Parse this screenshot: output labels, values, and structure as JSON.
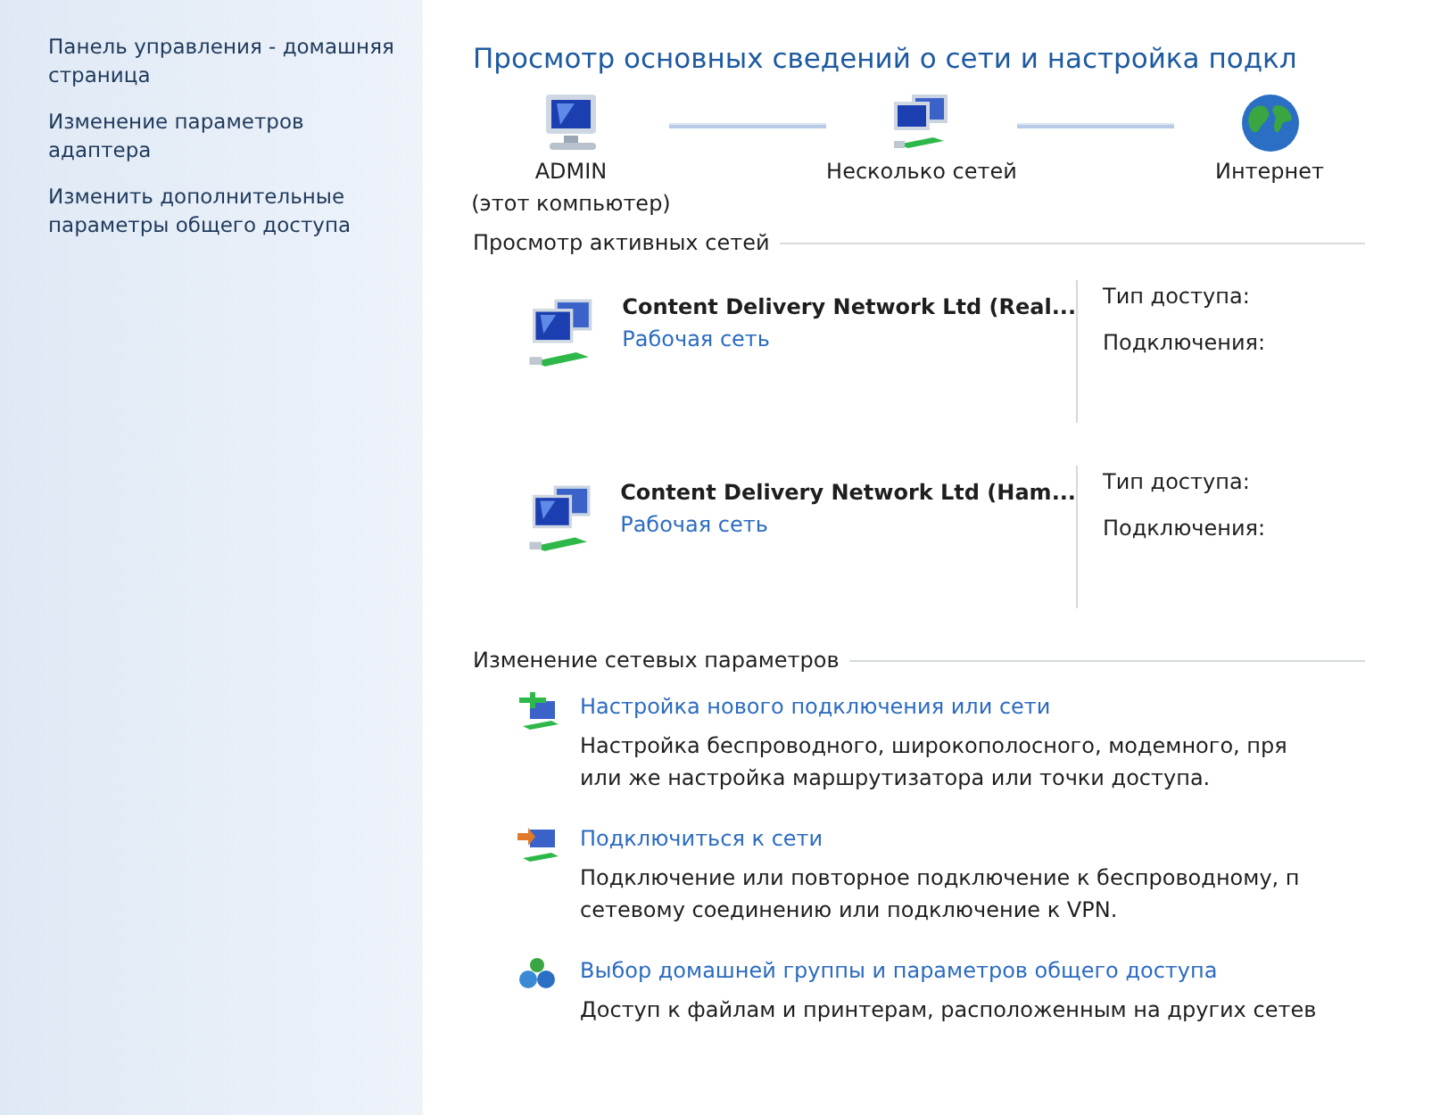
{
  "sidebar": {
    "links": [
      {
        "text": "Панель управления - домашняя страница"
      },
      {
        "text": "Изменение параметров адаптера"
      },
      {
        "text": "Изменить дополнительные параметры общего доступа"
      }
    ]
  },
  "title": "Просмотр основных сведений о сети и настройка подкл",
  "network_map": {
    "nodes": [
      {
        "kind": "computer",
        "label": "ADMIN",
        "sublabel": "(этот компьютер)"
      },
      {
        "kind": "networks",
        "label": "Несколько сетей"
      },
      {
        "kind": "internet",
        "label": "Интернет"
      }
    ]
  },
  "active_networks": {
    "heading": "Просмотр активных сетей",
    "networks": [
      {
        "name": "Content Delivery Network Ltd (Real...",
        "category": "Рабочая сеть",
        "access_type_label": "Тип доступа:",
        "connections_label": "Подключения:"
      },
      {
        "name": "Content Delivery Network Ltd (Ham...",
        "category": "Рабочая сеть",
        "access_type_label": "Тип доступа:",
        "connections_label": "Подключения:"
      }
    ]
  },
  "change_settings": {
    "heading": "Изменение сетевых параметров",
    "tasks": [
      {
        "kind": "new-connection",
        "link": "Настройка нового подключения или сети",
        "description": [
          "Настройка беспроводного, широкополосного, модемного, пря",
          "или же настройка маршрутизатора или точки доступа."
        ]
      },
      {
        "kind": "connect",
        "link": "Подключиться к сети",
        "description": [
          "Подключение или повторное подключение к беспроводному, п",
          "сетевому соединению или подключение к VPN."
        ]
      },
      {
        "kind": "homegroup",
        "link": "Выбор домашней группы и параметров общего доступа",
        "description": [
          "Доступ к файлам и принтерам, расположенным на других сетев"
        ]
      }
    ]
  }
}
